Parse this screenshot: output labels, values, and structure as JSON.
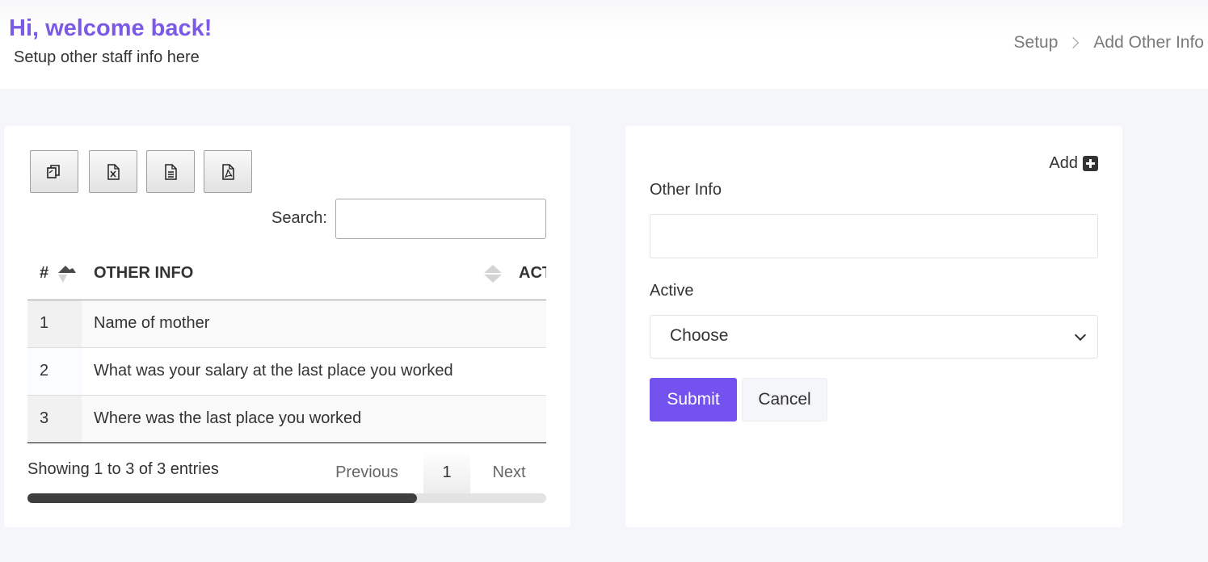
{
  "header": {
    "welcome": "Hi, welcome back!",
    "subtitle": "Setup other staff info here",
    "breadcrumb": [
      "Setup",
      "Add Other Info"
    ]
  },
  "table_panel": {
    "export_buttons": [
      {
        "name": "copy",
        "icon": "copy-icon"
      },
      {
        "name": "excel",
        "icon": "excel-file-icon"
      },
      {
        "name": "csv",
        "icon": "document-icon"
      },
      {
        "name": "pdf",
        "icon": "pdf-file-icon"
      }
    ],
    "search_label": "Search:",
    "search_value": "",
    "columns": [
      "#",
      "OTHER INFO",
      "ACT"
    ],
    "rows": [
      {
        "num": "1",
        "info": "Name of mother"
      },
      {
        "num": "2",
        "info": "What was your salary at the last place you worked"
      },
      {
        "num": "3",
        "info": "Where was the last place you worked"
      }
    ],
    "info": "Showing 1 to 3 of 3 entries",
    "pagination": {
      "previous": "Previous",
      "current": "1",
      "next": "Next"
    },
    "horizontal_scroll_fraction": 0.75
  },
  "form_panel": {
    "add_label": "Add",
    "other_info_label": "Other Info",
    "other_info_value": "",
    "active_label": "Active",
    "active_selected": "Choose",
    "submit_label": "Submit",
    "cancel_label": "Cancel"
  },
  "colors": {
    "accent": "#7352f0",
    "welcome": "#7b5ae6",
    "background": "#f5f6f9"
  }
}
